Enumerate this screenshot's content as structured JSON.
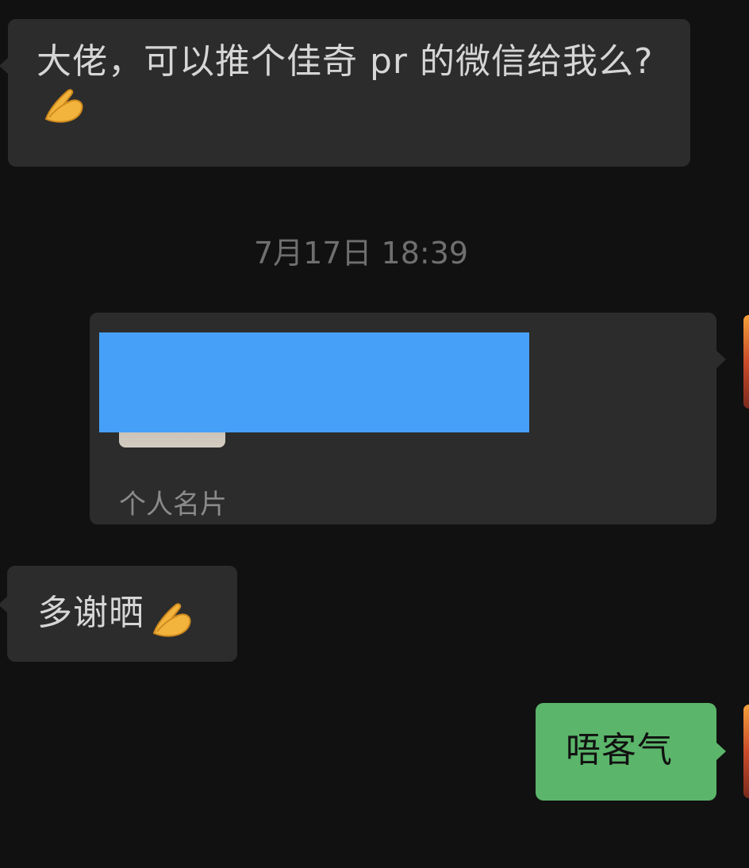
{
  "messages": [
    {
      "sender": "other",
      "text": "大佬，可以推个佳奇 pr 的微信给我么? ",
      "emoji": "folded-hands-icon"
    },
    {
      "sender": "other",
      "text": "多谢晒",
      "emoji": "folded-hands-icon"
    },
    {
      "sender": "self",
      "text": "唔客气"
    }
  ],
  "timestamp": "7月17日 18:39",
  "card": {
    "label": "个人名片"
  },
  "colors": {
    "background": "#111111",
    "bubble_other": "#2c2c2c",
    "bubble_self": "#5bb56a",
    "redaction": "#47a0f8"
  }
}
